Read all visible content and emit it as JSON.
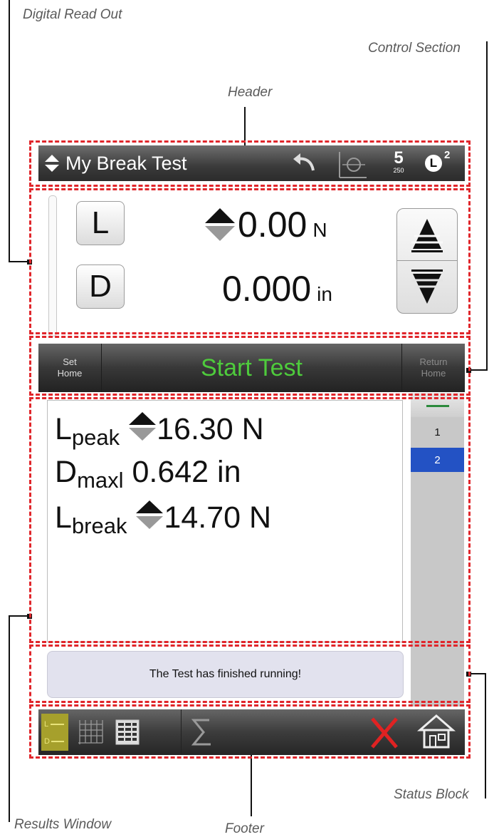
{
  "callouts": {
    "digital_read_out": "Digital Read Out",
    "control_section": "Control Section",
    "header": "Header",
    "results_window": "Results Window",
    "footer": "Footer",
    "status_block": "Status Block"
  },
  "header": {
    "title": "My Break Test",
    "speed_main": "5",
    "speed_sub": "250",
    "load_cell": "L",
    "load_cell_sup": "2"
  },
  "dro": {
    "load_key": "L",
    "load_value": "0.00",
    "load_unit": "N",
    "distance_key": "D",
    "distance_value": "0.000",
    "distance_unit": "in"
  },
  "control": {
    "set_home_line1": "Set",
    "set_home_line2": "Home",
    "start_test": "Start Test",
    "return_home_line1": "Return",
    "return_home_line2": "Home"
  },
  "results": {
    "lpeak_symbol": "L",
    "lpeak_sub": "peak",
    "lpeak_value": "16.30 N",
    "dmax_symbol": "D",
    "dmax_sub": "maxl",
    "dmax_value": "0.642 in",
    "lbreak_symbol": "L",
    "lbreak_sub": "break",
    "lbreak_value": "14.70 N"
  },
  "side_list": {
    "items": [
      "1",
      "2"
    ],
    "selected_color": "#2352c4"
  },
  "status": {
    "message": "The Test has finished running!"
  },
  "colors": {
    "dash_red": "#e0262b",
    "start_green": "#4ecb3c",
    "cancel_red": "#e02222"
  },
  "icons": {
    "header": [
      "updown-arrow-icon",
      "undo-icon",
      "graph-axis-icon",
      "speed-icon",
      "load-cell-icon"
    ],
    "footer": [
      "dro-view-icon",
      "graph-view-icon",
      "table-view-icon",
      "statistics-icon",
      "cancel-icon",
      "home-icon"
    ]
  }
}
